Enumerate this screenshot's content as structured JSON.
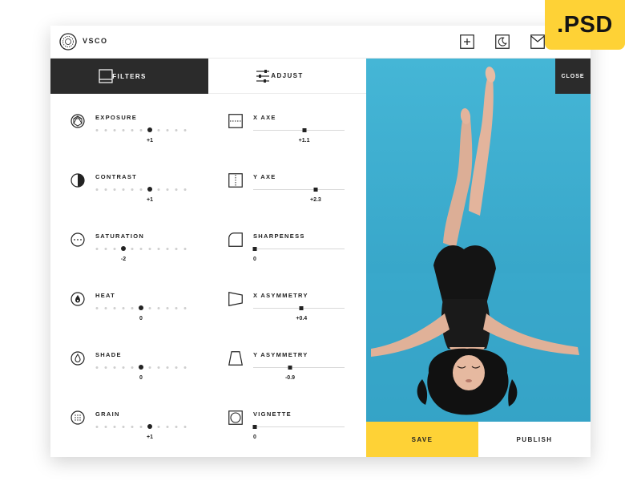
{
  "badge": ".PSD",
  "app": {
    "brand": "VSCO"
  },
  "top_icons": [
    "plus-icon",
    "moon-icon",
    "envelope-icon"
  ],
  "tabs": [
    {
      "label": "FILTERS",
      "icon": "photo-frame-icon",
      "active": true
    },
    {
      "label": "ADJUST",
      "icon": "sliders-icon",
      "active": false
    }
  ],
  "close_label": "CLOSE",
  "left_controls": [
    {
      "label": "EXPOSURE",
      "icon": "aperture-icon",
      "value": "+1",
      "level": 6,
      "steps": 11
    },
    {
      "label": "CONTRAST",
      "icon": "half-circle-icon",
      "value": "+1",
      "level": 6,
      "steps": 11
    },
    {
      "label": "SATURATION",
      "icon": "dotted-circle-icon",
      "value": "-2",
      "level": 3,
      "steps": 11
    },
    {
      "label": "HEAT",
      "icon": "flame-icon",
      "value": "0",
      "level": 5,
      "steps": 11
    },
    {
      "label": "SHADE",
      "icon": "droplet-icon",
      "value": "0",
      "level": 5,
      "steps": 11
    },
    {
      "label": "GRAIN",
      "icon": "grain-icon",
      "value": "+1",
      "level": 6,
      "steps": 11
    }
  ],
  "right_controls": [
    {
      "label": "X AXE",
      "icon": "x-axis-frame-icon",
      "value": "+1.1",
      "fraction": 0.56
    },
    {
      "label": "Y AXE",
      "icon": "y-axis-frame-icon",
      "value": "+2.3",
      "fraction": 0.69
    },
    {
      "label": "SHARPENESS",
      "icon": "rounded-corner-icon",
      "value": "0",
      "fraction": 0.0
    },
    {
      "label": "X ASYMMETRY",
      "icon": "x-asymmetry-icon",
      "value": "+0.4",
      "fraction": 0.53
    },
    {
      "label": "Y ASYMMETRY",
      "icon": "y-asymmetry-icon",
      "value": "-0.9",
      "fraction": 0.4
    },
    {
      "label": "VIGNETTE",
      "icon": "vignette-icon",
      "value": "0",
      "fraction": 0.0
    }
  ],
  "actions": {
    "save": "SAVE",
    "publish": "PUBLISH"
  },
  "colors": {
    "accent": "#fed236",
    "dark": "#2b2b2b",
    "water": "#3fb2d3"
  }
}
